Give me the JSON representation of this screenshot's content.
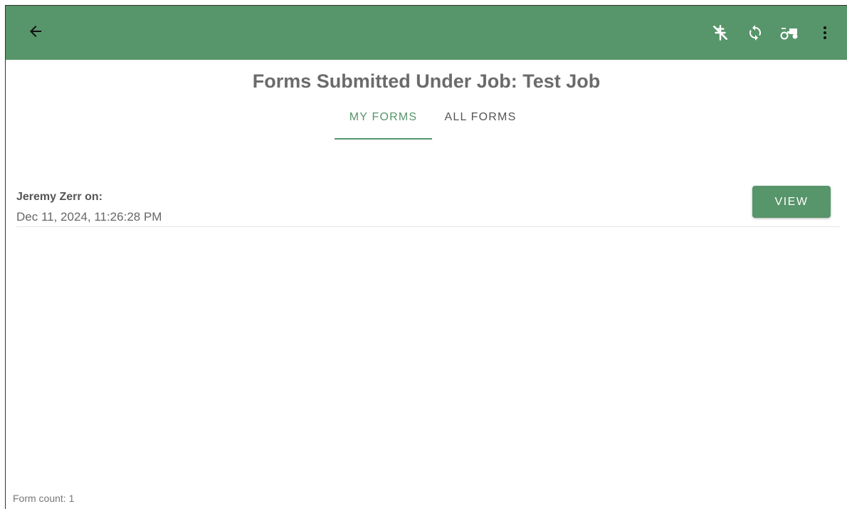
{
  "header": {
    "back_icon": "arrow-left-icon",
    "actions": [
      {
        "icon": "no-signal-icon"
      },
      {
        "icon": "sync-icon"
      },
      {
        "icon": "tractor-icon"
      },
      {
        "icon": "more-vert-icon"
      }
    ],
    "color": "#57956a"
  },
  "page": {
    "title": "Forms Submitted Under Job: Test Job"
  },
  "tabs": [
    {
      "label": "MY FORMS",
      "active": true
    },
    {
      "label": "ALL FORMS",
      "active": false
    }
  ],
  "forms": [
    {
      "submitter": "Jeremy Zerr on:",
      "date": "Dec 11, 2024, 11:26:28 PM",
      "button_label": "VIEW"
    }
  ],
  "footer": {
    "count_text": "Form count: 1"
  }
}
